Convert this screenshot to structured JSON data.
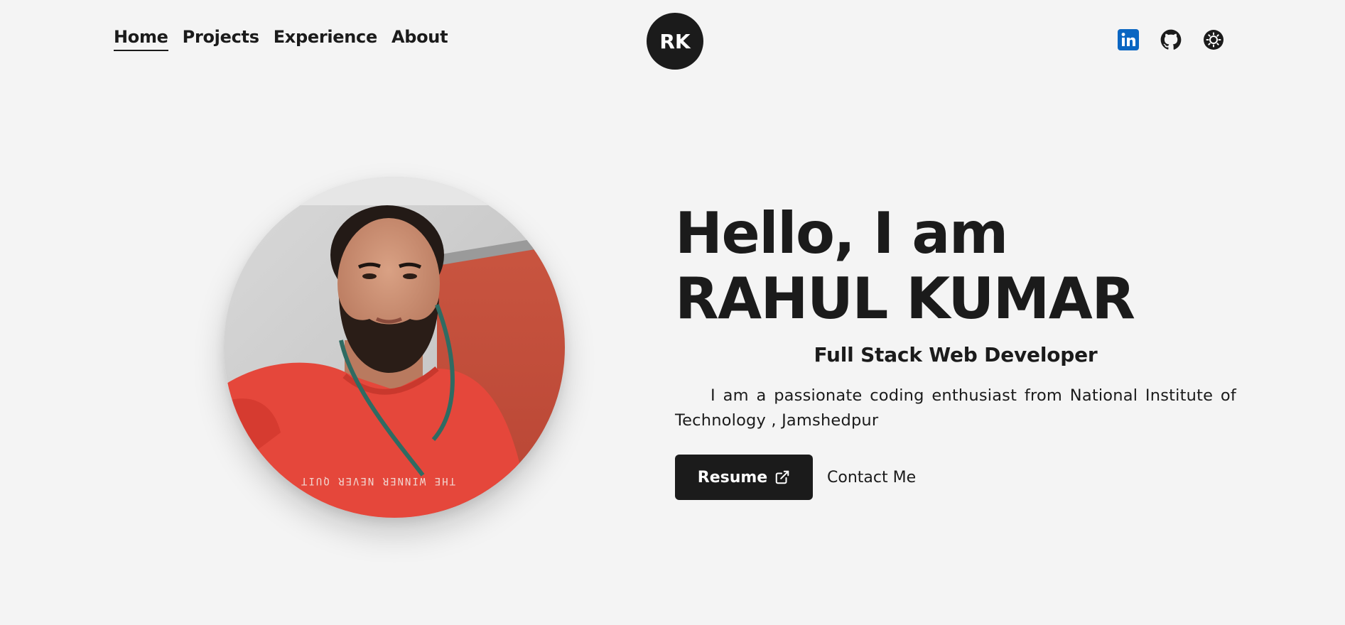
{
  "nav": {
    "items": [
      {
        "label": "Home",
        "active": true
      },
      {
        "label": "Projects",
        "active": false
      },
      {
        "label": "Experience",
        "active": false
      },
      {
        "label": "About",
        "active": false
      }
    ]
  },
  "logo": {
    "initials": "RK"
  },
  "socials": [
    {
      "icon": "linkedin-icon",
      "color": "#0a66c2"
    },
    {
      "icon": "github-icon",
      "color": "#1b1b1b"
    },
    {
      "icon": "theme-toggle-icon",
      "color": "#1b1b1b"
    }
  ],
  "hero": {
    "greeting": "Hello, I am",
    "name": "RAHUL KUMAR",
    "role": "Full Stack Web Developer",
    "bio": "I am a passionate coding enthusiast from National Institute of Technology , Jamshedpur",
    "resume_label": "Resume",
    "contact_label": "Contact Me",
    "shirt_text": "THE WINNER NEVER QUIT"
  },
  "colors": {
    "background": "#f4f4f4",
    "text": "#1b1b1b",
    "button": "#1b1b1b",
    "linkedin": "#0a66c2"
  }
}
